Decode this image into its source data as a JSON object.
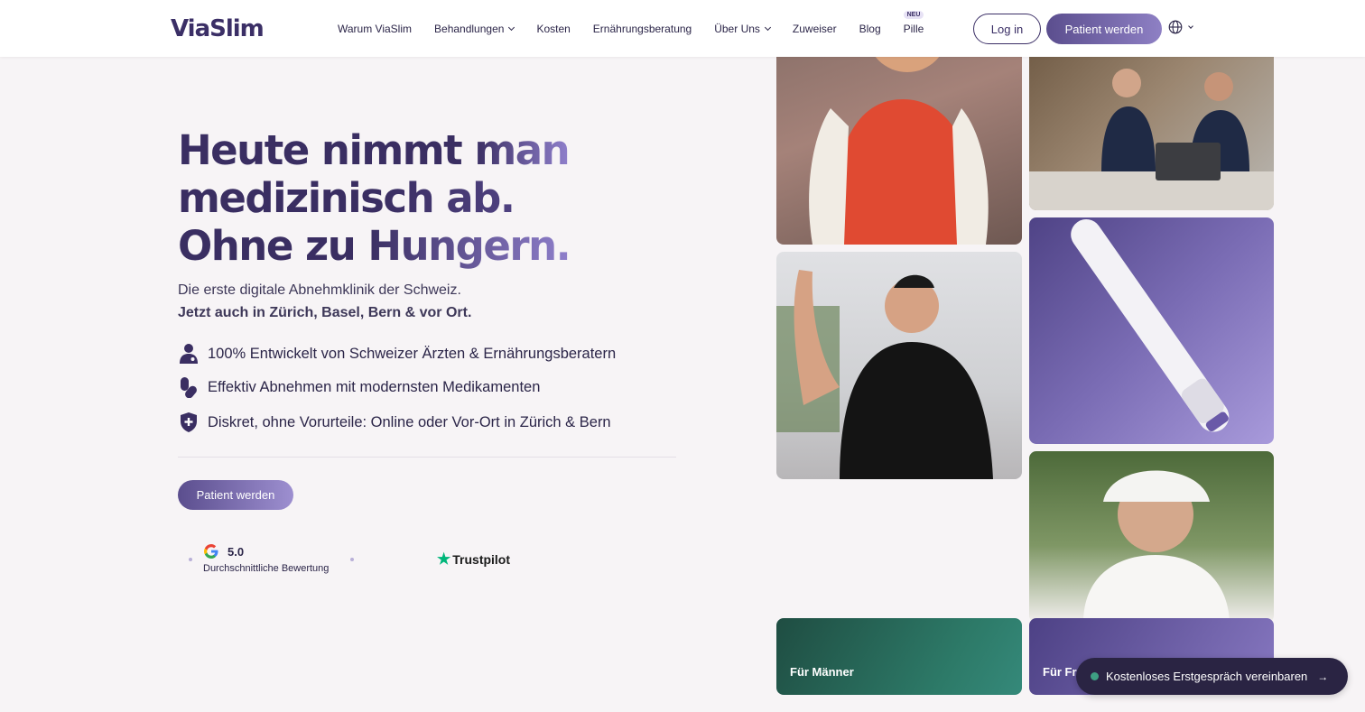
{
  "brand": {
    "logo_text_a": "Via",
    "logo_text_b": "Slim"
  },
  "nav": {
    "items": [
      {
        "label": "Warum ViaSlim",
        "has_dropdown": false
      },
      {
        "label": "Behandlungen",
        "has_dropdown": true
      },
      {
        "label": "Kosten",
        "has_dropdown": false
      },
      {
        "label": "Ernährungsberatung",
        "has_dropdown": false
      },
      {
        "label": "Über Uns",
        "has_dropdown": true
      },
      {
        "label": "Zuweiser",
        "has_dropdown": false
      },
      {
        "label": "Blog",
        "has_dropdown": false
      },
      {
        "label": "Pille",
        "has_dropdown": false,
        "badge": "NEU"
      }
    ],
    "login_label": "Log in",
    "patient_label": "Patient werden",
    "language_icon": "globe-icon"
  },
  "hero": {
    "headline_1a": "Heute nimmt ",
    "headline_1b": "man",
    "headline_2": "medizinisch ab.",
    "headline_3a": "Ohne zu ",
    "headline_3b": "Hungern.",
    "subline": "Die erste digitale Abnehmklinik der Schweiz.",
    "subline_bold": "Jetzt auch in Zürich, Basel, Bern & vor Ort.",
    "features": [
      {
        "icon": "doctor-icon",
        "text": "100% Entwickelt von Schweizer Ärzten & Ernährungsberatern"
      },
      {
        "icon": "pills-icon",
        "text": "Effektiv Abnehmen mit modernsten Medikamenten"
      },
      {
        "icon": "shield-plus-icon",
        "text": "Diskret, ohne Vorurteile: Online oder Vor-Ort in Zürich & Bern"
      }
    ],
    "cta_label": "Patient werden"
  },
  "ratings": {
    "google_score": "5.0",
    "google_label": "Durchschnittliche Bewertung",
    "trustpilot_label": "Trustpilot"
  },
  "cards": {
    "men_label": "Für Männer",
    "women_label": "Für Frauen"
  },
  "floating_cta": {
    "label": "Kostenloses Erstgespräch vereinbaren"
  },
  "colors": {
    "brand_dark": "#3a2e62",
    "brand_light": "#8f7fcb",
    "men_card": "#2d7a68",
    "women_card": "#6b5ba8",
    "status_dot": "#3e9f83"
  }
}
